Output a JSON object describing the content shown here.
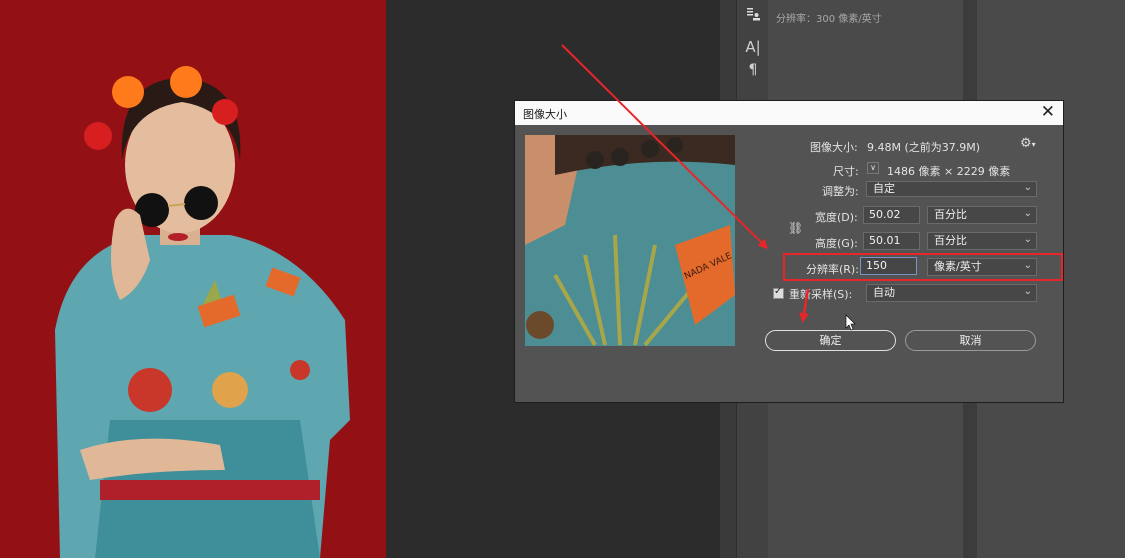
{
  "side_panel": {
    "resolution_info": "分辨率：300 像素/英寸"
  },
  "dialog": {
    "title": "图像大小",
    "close_glyph": "✕",
    "image_size_label": "图像大小:",
    "image_size_value": "9.48M (之前为37.9M)",
    "dimensions_label": "尺寸:",
    "dimensions_value": "1486 像素 × 2229 像素",
    "fit_to_label": "调整为:",
    "fit_to_value": "自定",
    "width_label": "宽度(D):",
    "width_value": "50.02",
    "width_unit": "百分比",
    "height_label": "高度(G):",
    "height_value": "50.01",
    "height_unit": "百分比",
    "resolution_label": "分辨率(R):",
    "resolution_value": "150",
    "resolution_unit": "像素/英寸",
    "resample_label": "重新采样(S):",
    "resample_checked": true,
    "resample_value": "自动",
    "ok_label": "确定",
    "cancel_label": "取消"
  },
  "annotations": {
    "arrow_color": "#e8262a",
    "highlight_color": "#e8262a"
  },
  "icons": {
    "side_top": "paragraph-styles-icon",
    "side_char": "character-icon",
    "side_para": "paragraph-icon",
    "gear": "gear-icon",
    "link": "chain-link-icon",
    "dropdown": "chevron-down-icon",
    "dims_toggle": "chevron-down-icon"
  }
}
